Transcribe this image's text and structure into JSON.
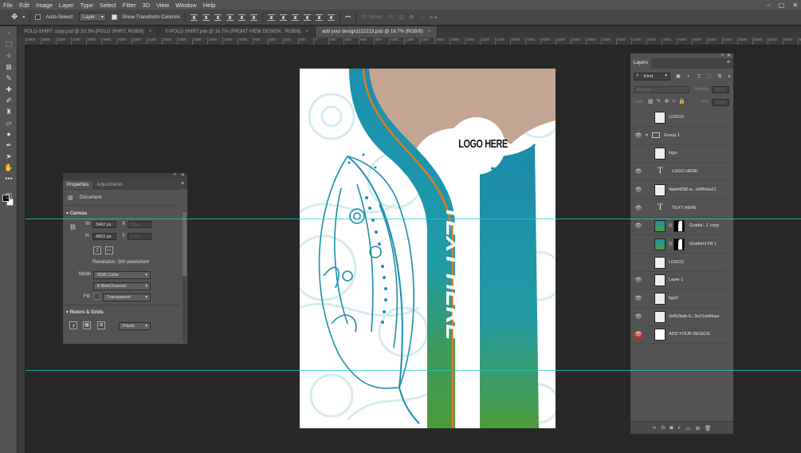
{
  "menubar": {
    "items": [
      "File",
      "Edit",
      "Image",
      "Layer",
      "Type",
      "Select",
      "Filter",
      "3D",
      "View",
      "Window",
      "Help"
    ]
  },
  "options": {
    "auto_select_label": "Auto-Select:",
    "auto_select_value": "Layer",
    "transform_label": "Show Transform Controls",
    "more": "•••",
    "mode_3d": "3D Mode:"
  },
  "tabs": [
    {
      "label": "POLO-SHIRT copy.psd @ 33.3% (POLO SHIRT, RGB/8)",
      "close": "×",
      "active": false
    },
    {
      "label": "© POLO SHIRT.psb @ 16.7% (FRONT VIEW DESIGN , RGB/8)",
      "close": "×",
      "active": false
    },
    {
      "label": "add your design1112213.psb @ 16.7% (RGB/8)",
      "close": "×",
      "active": true
    }
  ],
  "ruler": {
    "ticks": [
      "3800",
      "3600",
      "3400",
      "3200",
      "3000",
      "2800",
      "2600",
      "2400",
      "2200",
      "2000",
      "1800",
      "1600",
      "1400",
      "1200",
      "1000",
      "800",
      "600",
      "400",
      "200",
      "0",
      "200",
      "400",
      "600",
      "800",
      "1000",
      "1200",
      "1400",
      "1600",
      "1800",
      "2000",
      "2200",
      "2400",
      "2600",
      "2800",
      "3000",
      "3200",
      "3400",
      "3600",
      "3800",
      "4000",
      "4200",
      "4400",
      "4600",
      "4800",
      "5000",
      "5200",
      "5400",
      "5600",
      "5800",
      "6000",
      "6200",
      "6400",
      "6600",
      "6800",
      "7000"
    ]
  },
  "canvas": {
    "logo_text": "LOGO HERE",
    "main_text": "TEXT HERE",
    "colors": {
      "teal": "#1b93a8",
      "orange": "#e07b22",
      "beige": "#c3a591",
      "green": "#4d9b3a",
      "pattern": "#d7ecf0"
    }
  },
  "properties": {
    "tabs": [
      "Properties",
      "Adjustments"
    ],
    "doc_label": "Document",
    "canvas_header": "Canvas",
    "w_label": "W",
    "w_value": "3462 px",
    "x_label": "X",
    "x_placeholder": "0 px",
    "h_label": "H",
    "h_value": "4862 px",
    "y_label": "Y",
    "y_placeholder": "0 px",
    "resolution": "Resolution: 300 pixels/inch",
    "mode_label": "Mode",
    "mode_value": "RGB Color",
    "depth_value": "8 Bits/Channel",
    "fill_label": "Fill",
    "fill_value": "Transparent",
    "rulers_header": "Rulers & Grids",
    "units_value": "Pixels"
  },
  "layers": {
    "title": "Layers",
    "kind": "Kind",
    "blend": "Normal",
    "opacity_label": "Opacity:",
    "opacity_value": "100%",
    "lock_label": "Lock:",
    "fill_label": "Fill:",
    "fill_value": "100%",
    "items": [
      {
        "name": "LOGO3",
        "visible": false,
        "thumb": "check"
      },
      {
        "name": "Group 1",
        "visible": true,
        "thumb": "folder"
      },
      {
        "name": "logo",
        "visible": false,
        "thumb": "check"
      },
      {
        "name": "LOGO HERE",
        "visible": true,
        "thumb": "text"
      },
      {
        "name": "4abd4290-a...e5f8cba31",
        "visible": true,
        "thumb": "check"
      },
      {
        "name": "TEXT HERE",
        "visible": true,
        "thumb": "text"
      },
      {
        "name": "Gradie...1 copy",
        "visible": true,
        "thumb": "gradmask"
      },
      {
        "name": "Gradient Fill 1",
        "visible": false,
        "thumb": "gradmask"
      },
      {
        "name": "LOGO2",
        "visible": false,
        "thumb": "check"
      },
      {
        "name": "Layer 1",
        "visible": true,
        "thumb": "check"
      },
      {
        "name": "bgs2",
        "visible": true,
        "thumb": "check"
      },
      {
        "name": "2ef62bab-9...3e31dd4baa",
        "visible": true,
        "thumb": "check"
      },
      {
        "name": "ADD YOUR DESIGN",
        "visible": true,
        "thumb": "white",
        "selected": true
      }
    ]
  }
}
